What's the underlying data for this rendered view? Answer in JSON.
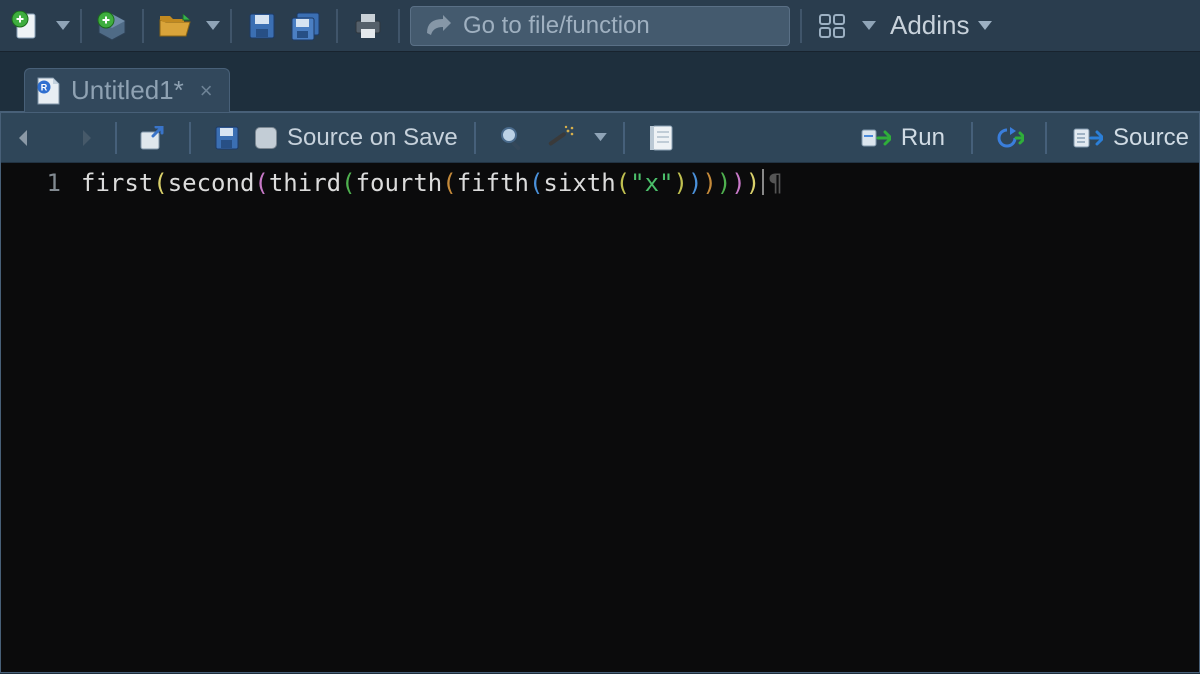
{
  "mainToolbar": {
    "gotoPlaceholder": "Go to file/function",
    "addinsLabel": "Addins"
  },
  "tab": {
    "title": "Untitled1*"
  },
  "editorToolbar": {
    "sourceOnSave": "Source on Save",
    "runLabel": "Run",
    "sourceLabel": "Source"
  },
  "code": {
    "lineNumber": "1",
    "tokens": {
      "first": "first",
      "second": "second",
      "third": "third",
      "fourth": "fourth",
      "fifth": "fifth",
      "sixth": "sixth",
      "string": "\"x\""
    }
  }
}
